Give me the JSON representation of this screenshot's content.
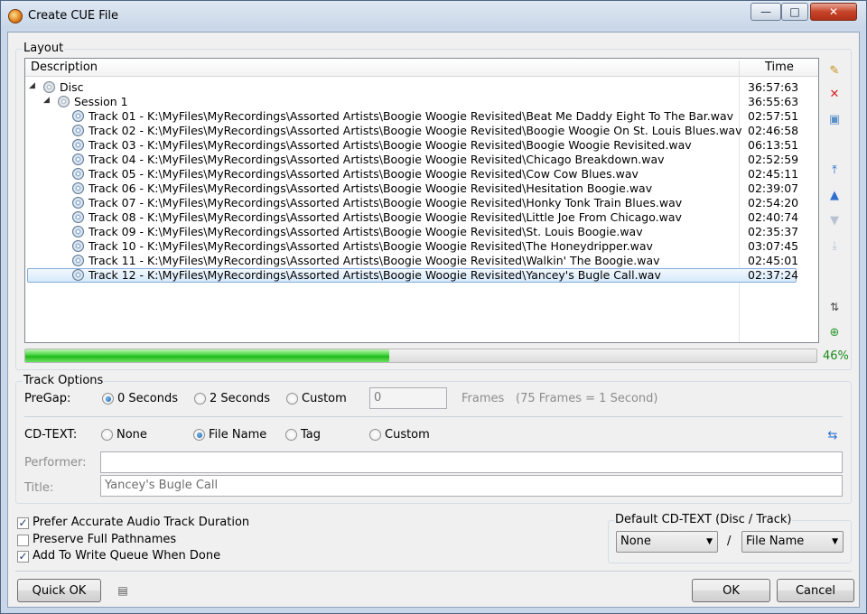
{
  "window": {
    "title": "Create CUE File",
    "minimize": "—",
    "maximize": "□",
    "close": "✕"
  },
  "layout": {
    "group_label": "Layout",
    "columns": {
      "description": "Description",
      "time": "Time"
    },
    "disc": {
      "label": "Disc",
      "time": "36:57:63"
    },
    "session": {
      "label": "Session 1",
      "time": "36:55:63"
    },
    "tracks": [
      {
        "label": "Track 01 - K:\\MyFiles\\MyRecordings\\Assorted Artists\\Boogie Woogie Revisited\\Beat Me Daddy Eight To The Bar.wav",
        "time": "02:57:51"
      },
      {
        "label": "Track 02 - K:\\MyFiles\\MyRecordings\\Assorted Artists\\Boogie Woogie Revisited\\Boogie Woogie On St. Louis Blues.wav",
        "time": "02:46:58"
      },
      {
        "label": "Track 03 - K:\\MyFiles\\MyRecordings\\Assorted Artists\\Boogie Woogie Revisited\\Boogie Woogie Revisited.wav",
        "time": "06:13:51"
      },
      {
        "label": "Track 04 - K:\\MyFiles\\MyRecordings\\Assorted Artists\\Boogie Woogie Revisited\\Chicago Breakdown.wav",
        "time": "02:52:59"
      },
      {
        "label": "Track 05 - K:\\MyFiles\\MyRecordings\\Assorted Artists\\Boogie Woogie Revisited\\Cow Cow Blues.wav",
        "time": "02:45:11"
      },
      {
        "label": "Track 06 - K:\\MyFiles\\MyRecordings\\Assorted Artists\\Boogie Woogie Revisited\\Hesitation Boogie.wav",
        "time": "02:39:07"
      },
      {
        "label": "Track 07 - K:\\MyFiles\\MyRecordings\\Assorted Artists\\Boogie Woogie Revisited\\Honky Tonk Train Blues.wav",
        "time": "02:54:20"
      },
      {
        "label": "Track 08 - K:\\MyFiles\\MyRecordings\\Assorted Artists\\Boogie Woogie Revisited\\Little Joe From Chicago.wav",
        "time": "02:40:74"
      },
      {
        "label": "Track 09 - K:\\MyFiles\\MyRecordings\\Assorted Artists\\Boogie Woogie Revisited\\St. Louis Boogie.wav",
        "time": "02:35:37"
      },
      {
        "label": "Track 10 - K:\\MyFiles\\MyRecordings\\Assorted Artists\\Boogie Woogie Revisited\\The Honeydripper.wav",
        "time": "03:07:45"
      },
      {
        "label": "Track 11 - K:\\MyFiles\\MyRecordings\\Assorted Artists\\Boogie Woogie Revisited\\Walkin' The Boogie.wav",
        "time": "02:45:01"
      },
      {
        "label": "Track 12 - K:\\MyFiles\\MyRecordings\\Assorted Artists\\Boogie Woogie Revisited\\Yancey's Bugle Call.wav",
        "time": "02:37:24",
        "selected": true
      }
    ],
    "progress": {
      "fraction": 0.46,
      "label": "46%"
    }
  },
  "track_options": {
    "group_label": "Track Options",
    "pregap": {
      "label": "PreGap:",
      "options": [
        "0 Seconds",
        "2 Seconds",
        "Custom"
      ],
      "selected": "0 Seconds",
      "custom_value": "0",
      "frames_label": "Frames",
      "frames_hint": "(75 Frames = 1 Second)"
    },
    "cdtext": {
      "label": "CD-TEXT:",
      "options": [
        "None",
        "File Name",
        "Tag",
        "Custom"
      ],
      "selected": "File Name"
    },
    "performer": {
      "label": "Performer:",
      "value": ""
    },
    "title": {
      "label": "Title:",
      "value": "Yancey's Bugle Call"
    }
  },
  "checkboxes": [
    {
      "label": "Prefer Accurate Audio Track Duration",
      "checked": true
    },
    {
      "label": "Preserve Full Pathnames",
      "checked": false
    },
    {
      "label": "Add To Write Queue When Done",
      "checked": true
    }
  ],
  "default_cdtext": {
    "label": "Default CD-TEXT (Disc / Track)",
    "disc_value": "None",
    "separator": "/",
    "track_value": "File Name"
  },
  "buttons": {
    "quick_ok": "Quick OK",
    "ok": "OK",
    "cancel": "Cancel"
  },
  "icons": {
    "add_file": "add-file-icon",
    "remove": "remove-icon",
    "clear": "clear-icon",
    "move_top": "move-top-icon",
    "move_up": "move-up-icon",
    "move_down": "move-down-icon",
    "move_bottom": "move-bottom-icon",
    "sort": "sort-icon",
    "add_globe": "globe-add-icon",
    "refresh": "refresh-icon",
    "log": "log-icon"
  }
}
